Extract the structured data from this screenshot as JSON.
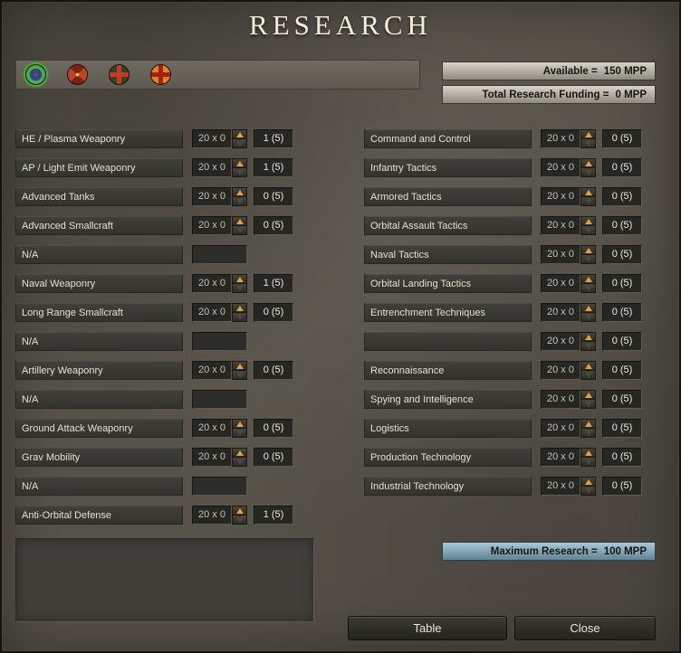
{
  "title": "RESEARCH",
  "header": {
    "available_label": "Available =",
    "available_value": "150 MPP",
    "funding_label": "Total Research Funding =",
    "funding_value": "0 MPP"
  },
  "flags": [
    {
      "name": "faction-flag-1",
      "selected": true
    },
    {
      "name": "faction-flag-2",
      "selected": false
    },
    {
      "name": "faction-flag-3",
      "selected": false
    },
    {
      "name": "faction-flag-4",
      "selected": false
    }
  ],
  "colors": {
    "accent_orange": "#e5a132",
    "max_bar_blue": "#7fa4b5",
    "background": "#57524a"
  },
  "columns": {
    "left": [
      {
        "label": "HE / Plasma Weaponry",
        "cost": "20 x 0",
        "count": "1 (5)"
      },
      {
        "label": "AP / Light Emit Weaponry",
        "cost": "20 x 0",
        "count": "1 (5)"
      },
      {
        "label": "Advanced Tanks",
        "cost": "20 x 0",
        "count": "0 (5)"
      },
      {
        "label": "Advanced Smallcraft",
        "cost": "20 x 0",
        "count": "0 (5)"
      },
      {
        "label": "N/A",
        "na": true
      },
      {
        "label": "Naval Weaponry",
        "cost": "20 x 0",
        "count": "1 (5)"
      },
      {
        "label": "Long Range Smallcraft",
        "cost": "20 x 0",
        "count": "0 (5)"
      },
      {
        "label": "N/A",
        "na": true
      },
      {
        "label": "Artillery Weaponry",
        "cost": "20 x 0",
        "count": "0 (5)"
      },
      {
        "label": "N/A",
        "na": true
      },
      {
        "label": "Ground Attack Weaponry",
        "cost": "20 x 0",
        "count": "0 (5)"
      },
      {
        "label": "Grav Mobility",
        "cost": "20 x 0",
        "count": "0 (5)"
      },
      {
        "label": "N/A",
        "na": true
      },
      {
        "label": "Anti-Orbital Defense",
        "cost": "20 x 0",
        "count": "1 (5)"
      }
    ],
    "right": [
      {
        "label": "Command and Control",
        "cost": "20 x 0",
        "count": "0 (5)"
      },
      {
        "label": "Infantry Tactics",
        "cost": "20 x 0",
        "count": "0 (5)"
      },
      {
        "label": "Armored Tactics",
        "cost": "20 x 0",
        "count": "0 (5)"
      },
      {
        "label": "Orbital Assault Tactics",
        "cost": "20 x 0",
        "count": "0 (5)"
      },
      {
        "label": "Naval Tactics",
        "cost": "20 x 0",
        "count": "0 (5)"
      },
      {
        "label": "Orbital Landing Tactics",
        "cost": "20 x 0",
        "count": "0 (5)"
      },
      {
        "label": "Entrenchment Techniques",
        "cost": "20 x 0",
        "count": "0 (5)"
      },
      {
        "label": "",
        "cost": "20 x 0",
        "count": "0 (5)"
      },
      {
        "label": "Reconnaissance",
        "cost": "20 x 0",
        "count": "0 (5)"
      },
      {
        "label": "Spying and Intelligence",
        "cost": "20 x 0",
        "count": "0 (5)"
      },
      {
        "label": "Logistics",
        "cost": "20 x 0",
        "count": "0 (5)"
      },
      {
        "label": "Production Technology",
        "cost": "20 x 0",
        "count": "0 (5)"
      },
      {
        "label": "Industrial Technology",
        "cost": "20 x 0",
        "count": "0 (5)"
      }
    ]
  },
  "footer": {
    "maximum_label": "Maximum Research =",
    "maximum_value": "100 MPP",
    "table_button": "Table",
    "close_button": "Close"
  }
}
